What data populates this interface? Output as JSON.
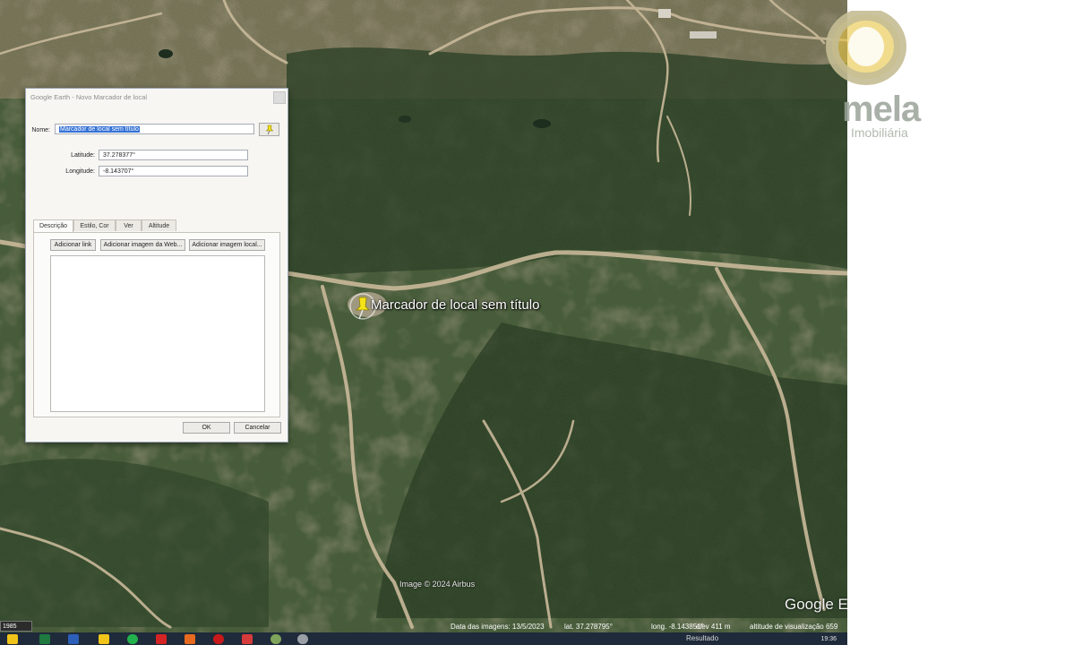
{
  "dialog": {
    "title": "Google Earth - Novo Marcador de local",
    "name_label": "Nome:",
    "name_value": "Marcador de local sem título",
    "latitude_label": "Latitude:",
    "latitude_value": "37.278377°",
    "longitude_label": "Longitude:",
    "longitude_value": "-8.143707°",
    "tabs": [
      {
        "label": "Descrição"
      },
      {
        "label": "Estilo, Cor"
      },
      {
        "label": "Ver"
      },
      {
        "label": "Altitude"
      }
    ],
    "add_link": "Adicionar link",
    "add_web_image": "Adicionar imagem da Web...",
    "add_local_image": "Adicionar imagem local...",
    "description_value": "",
    "ok_label": "OK",
    "cancel_label": "Cancelar",
    "icon": "pushpin-icon"
  },
  "map": {
    "placemark_label": "Marcador de local sem título",
    "copyright": "Image © 2024 Airbus",
    "watermark": "Google Earth",
    "year": "1985"
  },
  "status": {
    "imagery_date": "Data das imagens: 13/5/2023",
    "lat": "lat.  37.278795°",
    "long": "long.  -8.143851°",
    "elev": "elev  411 m",
    "eye_alt": "altitude de visualização  659"
  },
  "logo": {
    "text": "mela",
    "subtitle": "Imobiliária",
    "ring_color": "#c4bd93",
    "accent_color": "#e5c847"
  },
  "taskbar": {
    "search_label": "Resultado",
    "clock": "19:36"
  }
}
